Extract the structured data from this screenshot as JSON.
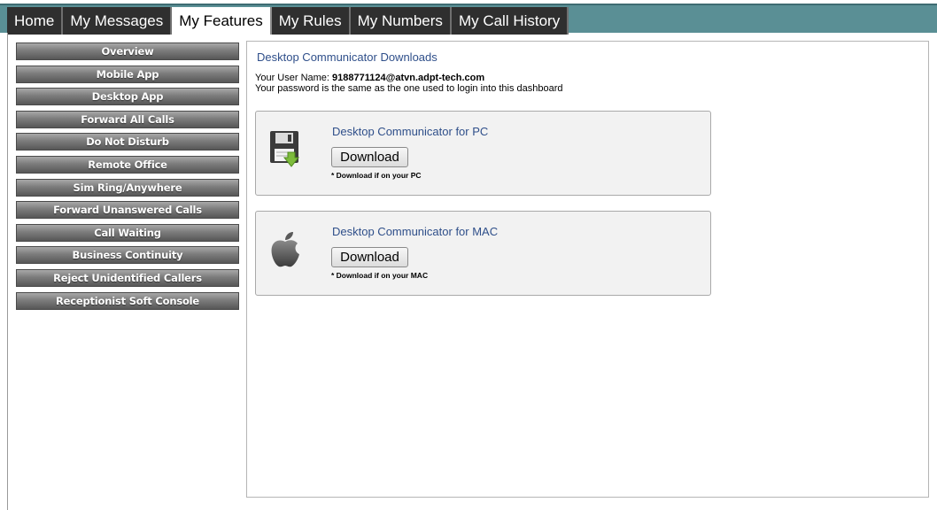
{
  "nav": {
    "tabs": [
      {
        "label": "Home",
        "active": false
      },
      {
        "label": "My Messages",
        "active": false
      },
      {
        "label": "My Features",
        "active": true
      },
      {
        "label": "My Rules",
        "active": false
      },
      {
        "label": "My Numbers",
        "active": false
      },
      {
        "label": "My Call History",
        "active": false
      }
    ]
  },
  "sidebar": {
    "items": [
      {
        "label": "Overview"
      },
      {
        "label": "Mobile App"
      },
      {
        "label": "Desktop App"
      },
      {
        "label": "Forward All Calls"
      },
      {
        "label": "Do Not Disturb"
      },
      {
        "label": "Remote Office"
      },
      {
        "label": "Sim Ring/Anywhere"
      },
      {
        "label": "Forward Unanswered Calls"
      },
      {
        "label": "Call Waiting"
      },
      {
        "label": "Business Continuity"
      },
      {
        "label": "Reject Unidentified Callers"
      },
      {
        "label": "Receptionist Soft Console"
      }
    ]
  },
  "main": {
    "title": "Desktop Communicator Downloads",
    "username_label": "Your User Name: ",
    "username_value": "9188771124@atvn.adpt-tech.com",
    "password_note": "Your password is the same as the one used to login into this dashboard",
    "downloads": {
      "pc": {
        "heading": "Desktop Communicator for PC",
        "button_label": "Download",
        "note": "* Download if on your PC",
        "icon": "floppy-disk-icon"
      },
      "mac": {
        "heading": "Desktop Communicator for MAC",
        "button_label": "Download",
        "note": "* Download if on your MAC",
        "icon": "apple-logo-icon"
      }
    }
  },
  "colors": {
    "topbar": "#5a8f95",
    "tab_bg": "#2f2f2f",
    "link_blue": "#2f4f8a"
  }
}
